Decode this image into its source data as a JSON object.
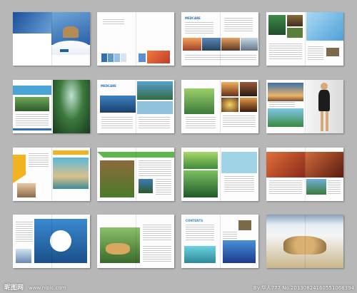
{
  "background_color": "#b7b7b7",
  "brochure": {
    "brand_label": "MEDCARE",
    "section_label": "CONTENTS"
  },
  "watermark": {
    "left": "昵图网",
    "site": "www.nipic.com",
    "right": "By:华人777  No.20130824160551068394"
  }
}
